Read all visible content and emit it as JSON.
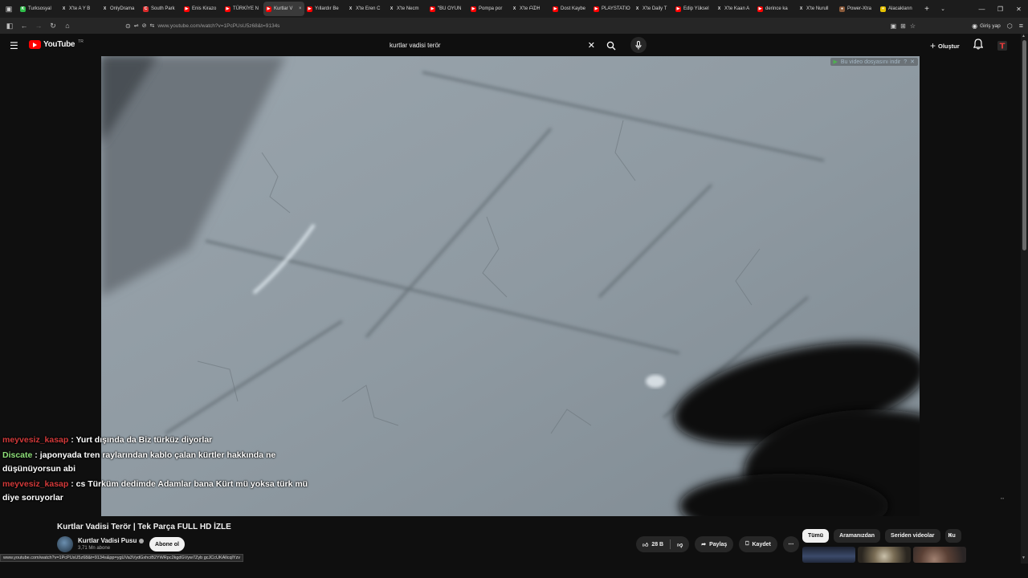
{
  "browser": {
    "tabs": [
      {
        "label": "Turksosyal",
        "color": "#2fbf4a",
        "glyph": "K",
        "active": false
      },
      {
        "label": "X'te A Y B",
        "color": "#000000",
        "glyph": "X",
        "active": false
      },
      {
        "label": "OnlyDrama",
        "color": "#000000",
        "glyph": "X",
        "active": false
      },
      {
        "label": "South Park",
        "color": "#d92c2c",
        "glyph": "C",
        "active": false
      },
      {
        "label": "Enis Kirazo",
        "color": "#ff0000",
        "glyph": "▶",
        "active": false
      },
      {
        "label": "TÜRKİYE N",
        "color": "#ff0000",
        "glyph": "▶",
        "active": false
      },
      {
        "label": "Kurtlar V",
        "color": "#ff0000",
        "glyph": "▶",
        "active": true
      },
      {
        "label": "Yıllardır Be",
        "color": "#ff0000",
        "glyph": "▶",
        "active": false
      },
      {
        "label": "X'te Eren C",
        "color": "#000000",
        "glyph": "X",
        "active": false
      },
      {
        "label": "X'te Necm",
        "color": "#000000",
        "glyph": "X",
        "active": false
      },
      {
        "label": "\"BU OYUN",
        "color": "#ff0000",
        "glyph": "▶",
        "active": false
      },
      {
        "label": "Pompa por",
        "color": "#ff0000",
        "glyph": "▶",
        "active": false
      },
      {
        "label": "X'te ᗩᗪᕼ",
        "color": "#000000",
        "glyph": "X",
        "active": false
      },
      {
        "label": "Dost Kaybe",
        "color": "#ff0000",
        "glyph": "▶",
        "active": false
      },
      {
        "label": "PLAYSTATIO",
        "color": "#ff0000",
        "glyph": "▶",
        "active": false
      },
      {
        "label": "X'te Daily T",
        "color": "#000000",
        "glyph": "X",
        "active": false
      },
      {
        "label": "Edip Yüksel",
        "color": "#ff0000",
        "glyph": "▶",
        "active": false
      },
      {
        "label": "X'te Kaan A",
        "color": "#000000",
        "glyph": "X",
        "active": false
      },
      {
        "label": "derince ka",
        "color": "#ff0000",
        "glyph": "▶",
        "active": false
      },
      {
        "label": "X'te Nurull",
        "color": "#000000",
        "glyph": "X",
        "active": false
      },
      {
        "label": "Power-Xtra",
        "color": "#8a5a3a",
        "glyph": "●",
        "active": false
      },
      {
        "label": "Alacakların",
        "color": "#e6c200",
        "glyph": "+",
        "active": false
      }
    ],
    "new_tab": "+",
    "tab_list": "⌄",
    "url": "www.youtube.com/watch?v=1PcPUsU5z68&t=9134s",
    "signin_label": "Giriş yap",
    "status_url": "www.youtube.com/watch?v=1PcPUsU5z68&t=9134s&pp=ygUVa3VydGxhciB2YWRpc2kgdGVyw7Zyb gcJCcUKAllcqlYzv"
  },
  "youtube": {
    "logo_text": "YouTube",
    "logo_country": "TR",
    "search_query": "kurtlar vadisi terör",
    "create_label": "Oluştur",
    "download_banner": "Bu video dosyasını indir"
  },
  "chat": [
    {
      "user": "meyvesiz_kasap",
      "user_color": "red",
      "text": ": Yurt dışında da Biz türküz diyorlar"
    },
    {
      "user": "Discate",
      "user_color": "green",
      "text": ": japonyada tren raylarından kablo çalan kürtler hakkında ne düşünüyorsun abi"
    },
    {
      "user": "meyvesiz_kasap",
      "user_color": "red",
      "text": ": cs Türküm dedimde Adamlar bana Kürt mü yoksa türk mü diye soruyorlar"
    }
  ],
  "video": {
    "title": "Kurtlar Vadisi Terör | Tek Parça FULL HD İZLE",
    "channel": "Kurtlar Vadisi Pusu",
    "subscribers": "3,71 Mn abone",
    "subscribe_label": "Abone ol",
    "likes": "28 B",
    "share_label": "Paylaş",
    "save_label": "Kaydet",
    "more_label": "⋯"
  },
  "chips": [
    {
      "label": "Tümü",
      "active": true
    },
    {
      "label": "Aramanızdan",
      "active": false
    },
    {
      "label": "Seriden videolar",
      "active": false
    },
    {
      "label": "Ku",
      "active": false
    }
  ]
}
